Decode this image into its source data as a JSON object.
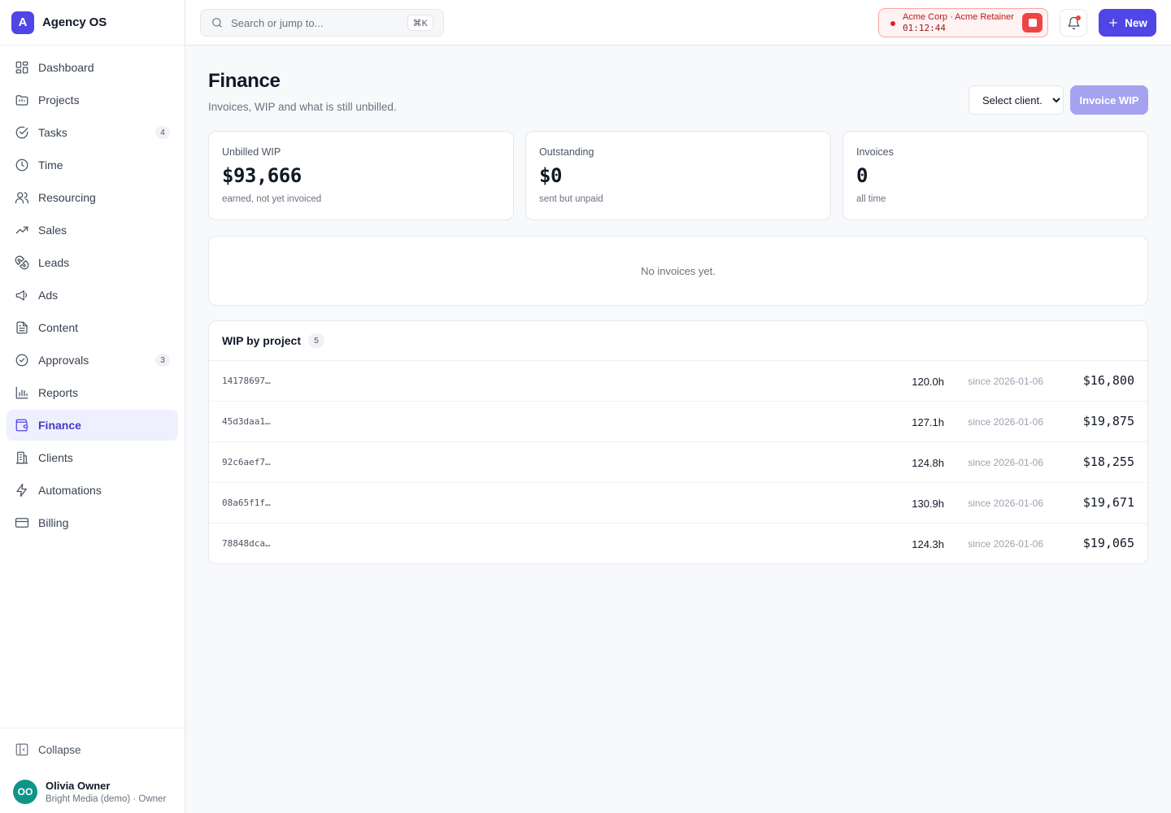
{
  "brand": {
    "logo_letter": "A",
    "name": "Agency OS"
  },
  "sidebar": {
    "items": [
      {
        "label": "Dashboard",
        "icon": "grid-icon",
        "badge": ""
      },
      {
        "label": "Projects",
        "icon": "folder-icon",
        "badge": ""
      },
      {
        "label": "Tasks",
        "icon": "check-circle-icon",
        "badge": "4"
      },
      {
        "label": "Time",
        "icon": "clock-icon",
        "badge": ""
      },
      {
        "label": "Resourcing",
        "icon": "users-icon",
        "badge": ""
      },
      {
        "label": "Sales",
        "icon": "trending-up-icon",
        "badge": ""
      },
      {
        "label": "Leads",
        "icon": "magnet-icon",
        "badge": ""
      },
      {
        "label": "Ads",
        "icon": "megaphone-icon",
        "badge": ""
      },
      {
        "label": "Content",
        "icon": "document-icon",
        "badge": ""
      },
      {
        "label": "Approvals",
        "icon": "badge-check-icon",
        "badge": "3"
      },
      {
        "label": "Reports",
        "icon": "bar-chart-icon",
        "badge": ""
      },
      {
        "label": "Finance",
        "icon": "wallet-icon",
        "badge": "",
        "active": true
      },
      {
        "label": "Clients",
        "icon": "building-icon",
        "badge": ""
      },
      {
        "label": "Automations",
        "icon": "zap-icon",
        "badge": ""
      },
      {
        "label": "Billing",
        "icon": "credit-card-icon",
        "badge": ""
      }
    ],
    "collapse_label": "Collapse",
    "user": {
      "initials": "OO",
      "name": "Olivia Owner",
      "subtitle": "Bright Media (demo) · Owner"
    }
  },
  "topbar": {
    "search_placeholder": "Search or jump to...",
    "search_shortcut": "⌘K",
    "timer": {
      "label": "Acme Corp · Acme Retainer",
      "elapsed": "01:12:44"
    },
    "new_label": "New"
  },
  "colors": {
    "accent": "#4f46e5",
    "timer_red": "#ef4444",
    "avatar_teal": "#0f9488"
  },
  "page": {
    "title": "Finance",
    "subtitle": "Invoices, WIP and what is still unbilled.",
    "client_select": {
      "selected": "Select client..."
    },
    "invoice_button": "Invoice WIP"
  },
  "stats": [
    {
      "label": "Unbilled WIP",
      "value": "$93,666",
      "sub": "earned, not yet invoiced"
    },
    {
      "label": "Outstanding",
      "value": "$0",
      "sub": "sent but unpaid"
    },
    {
      "label": "Invoices",
      "value": "0",
      "sub": "all time"
    }
  ],
  "invoices_empty": "No invoices yet.",
  "wip": {
    "title": "WIP by project",
    "count": "5",
    "rows": [
      {
        "id": "14178697…",
        "hours": "120.0h",
        "since": "since 2026-01-06",
        "amount": "$16,800"
      },
      {
        "id": "45d3daa1…",
        "hours": "127.1h",
        "since": "since 2026-01-06",
        "amount": "$19,875"
      },
      {
        "id": "92c6aef7…",
        "hours": "124.8h",
        "since": "since 2026-01-06",
        "amount": "$18,255"
      },
      {
        "id": "08a65f1f…",
        "hours": "130.9h",
        "since": "since 2026-01-06",
        "amount": "$19,671"
      },
      {
        "id": "78848dca…",
        "hours": "124.3h",
        "since": "since 2026-01-06",
        "amount": "$19,065"
      }
    ]
  }
}
